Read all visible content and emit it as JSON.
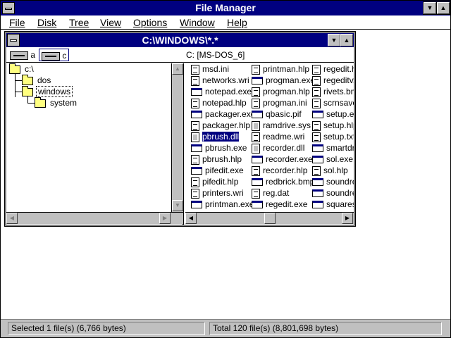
{
  "app": {
    "title": "File Manager"
  },
  "menu": [
    {
      "label": "File"
    },
    {
      "label": "Disk"
    },
    {
      "label": "Tree"
    },
    {
      "label": "View"
    },
    {
      "label": "Options"
    },
    {
      "label": "Window"
    },
    {
      "label": "Help"
    }
  ],
  "child_window": {
    "title": "C:\\WINDOWS\\*.*"
  },
  "drives": [
    {
      "label": "a",
      "selected": false
    },
    {
      "label": "c",
      "selected": true
    }
  ],
  "volume_label": "C: [MS-DOS_6]",
  "tree": [
    {
      "label": "c:\\",
      "icon": "folder-open-icon",
      "level": 0
    },
    {
      "label": "dos",
      "icon": "folder-icon",
      "level": 1
    },
    {
      "label": "windows",
      "icon": "folder-open-icon",
      "level": 1,
      "focused": true
    },
    {
      "label": "system",
      "icon": "folder-icon",
      "level": 2
    }
  ],
  "files": {
    "columns": [
      [
        {
          "name": "msd.ini",
          "type": "doc"
        },
        {
          "name": "networks.wri",
          "type": "doc"
        },
        {
          "name": "notepad.exe",
          "type": "exe"
        },
        {
          "name": "notepad.hlp",
          "type": "doc"
        },
        {
          "name": "packager.exe",
          "type": "exe"
        },
        {
          "name": "packager.hlp",
          "type": "doc"
        },
        {
          "name": "pbrush.dll",
          "type": "sys",
          "selected": true
        },
        {
          "name": "pbrush.exe",
          "type": "exe"
        },
        {
          "name": "pbrush.hlp",
          "type": "doc"
        },
        {
          "name": "pifedit.exe",
          "type": "exe"
        },
        {
          "name": "pifedit.hlp",
          "type": "doc"
        },
        {
          "name": "printers.wri",
          "type": "doc"
        },
        {
          "name": "printman.exe",
          "type": "exe"
        }
      ],
      [
        {
          "name": "printman.hlp",
          "type": "doc"
        },
        {
          "name": "progman.exe",
          "type": "exe"
        },
        {
          "name": "progman.hlp",
          "type": "doc"
        },
        {
          "name": "progman.ini",
          "type": "doc"
        },
        {
          "name": "qbasic.pif",
          "type": "exe"
        },
        {
          "name": "ramdrive.sys",
          "type": "sys"
        },
        {
          "name": "readme.wri",
          "type": "doc"
        },
        {
          "name": "recorder.dll",
          "type": "sys"
        },
        {
          "name": "recorder.exe",
          "type": "exe"
        },
        {
          "name": "recorder.hlp",
          "type": "doc"
        },
        {
          "name": "redbrick.bmp",
          "type": "exe"
        },
        {
          "name": "reg.dat",
          "type": "doc"
        },
        {
          "name": "regedit.exe",
          "type": "exe"
        }
      ],
      [
        {
          "name": "regedit.hlp",
          "type": "doc"
        },
        {
          "name": "regeditv.hlp",
          "type": "doc"
        },
        {
          "name": "rivets.bmp",
          "type": "doc"
        },
        {
          "name": "scrnsave.scr",
          "type": "doc"
        },
        {
          "name": "setup.exe",
          "type": "exe"
        },
        {
          "name": "setup.hlp",
          "type": "doc"
        },
        {
          "name": "setup.txt",
          "type": "doc"
        },
        {
          "name": "smartdrv.exe",
          "type": "exe"
        },
        {
          "name": "sol.exe",
          "type": "exe"
        },
        {
          "name": "sol.hlp",
          "type": "doc"
        },
        {
          "name": "soundrec.exe",
          "type": "exe"
        },
        {
          "name": "soundrec.hlp",
          "type": "exe"
        },
        {
          "name": "squares.bmp",
          "type": "exe"
        }
      ]
    ]
  },
  "status": {
    "selected": "Selected 1 file(s) (6,766 bytes)",
    "total": "Total 120 file(s) (8,801,698 bytes)"
  }
}
